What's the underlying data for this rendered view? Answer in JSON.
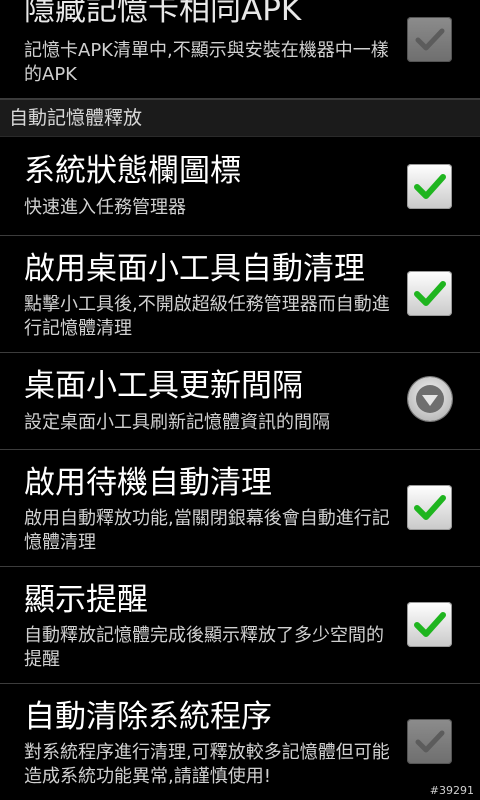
{
  "rows": {
    "hide_same_apk": {
      "title": "隱藏記憶卡相同APK",
      "summary": "記憶卡APK清單中,不顯示與安裝在機器中一樣的APK",
      "checked": true,
      "enabled": false
    },
    "section_header": "自動記憶體釋放",
    "status_bar_icon": {
      "title": "系統狀態欄圖標",
      "summary": "快速進入任務管理器",
      "checked": true,
      "enabled": true
    },
    "widget_auto_clean": {
      "title": "啟用桌面小工具自動清理",
      "summary": "點擊小工具後,不開啟超級任務管理器而自動進行記憶體清理",
      "checked": true,
      "enabled": true
    },
    "widget_update_interval": {
      "title": "桌面小工具更新間隔",
      "summary": "設定桌面小工具刷新記憶體資訊的間隔"
    },
    "standby_auto_clean": {
      "title": "啟用待機自動清理",
      "summary": "啟用自動釋放功能,當關閉銀幕後會自動進行記憶體清理",
      "checked": true,
      "enabled": true
    },
    "show_reminder": {
      "title": "顯示提醒",
      "summary": "自動釋放記憶體完成後顯示釋放了多少空間的提醒",
      "checked": true,
      "enabled": true
    },
    "auto_kill_system": {
      "title": "自動清除系統程序",
      "summary": "對系統程序進行清理,可釋放較多記憶體但可能造成系統功能異常,請謹慎使用!",
      "checked": true,
      "enabled": false
    }
  },
  "watermark": "#39291",
  "colors": {
    "check_green": "#1fb51f",
    "check_disabled": "#a8a8a8",
    "background": "#000000"
  }
}
